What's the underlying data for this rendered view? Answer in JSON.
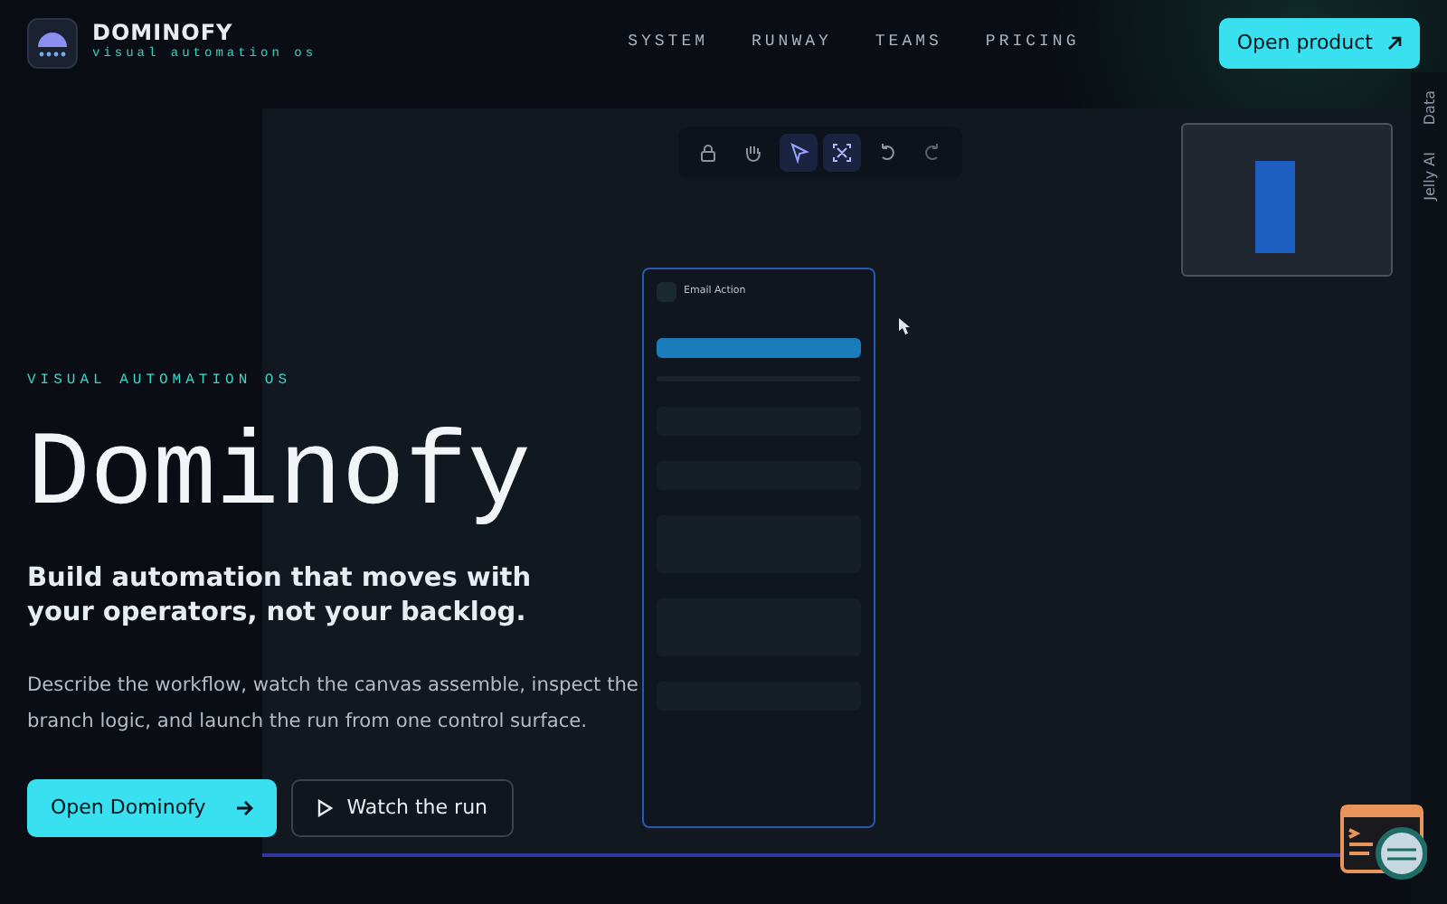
{
  "brand": {
    "name": "DOMINOFY",
    "tagline": "visual automation os"
  },
  "nav": [
    {
      "label": "SYSTEM"
    },
    {
      "label": "RUNWAY"
    },
    {
      "label": "TEAMS"
    },
    {
      "label": "PRICING"
    }
  ],
  "header_button": {
    "label": "Open product"
  },
  "hero": {
    "eyebrow": "VISUAL AUTOMATION OS",
    "title": "Dominofy",
    "subtitle": "Build automation that moves with your operators, not your backlog.",
    "description": "Describe the workflow, watch the canvas assemble, inspect the branch logic, and launch the run from one control surface.",
    "buttons": [
      {
        "kind": "primary",
        "label": "Open Dominofy"
      },
      {
        "kind": "secondary",
        "label": "Watch the run"
      }
    ]
  },
  "canvas": {
    "toolbar": [
      {
        "kind": "lock",
        "selected": false
      },
      {
        "kind": "hand",
        "selected": false
      },
      {
        "kind": "pointer",
        "selected": true
      },
      {
        "kind": "fit",
        "selected": true
      },
      {
        "kind": "undo",
        "selected": false
      },
      {
        "kind": "redo",
        "selected": false
      }
    ],
    "node": {
      "title": "Email Action",
      "fields": [
        {
          "kind": "button"
        },
        {
          "kind": "line"
        },
        {
          "kind": "input"
        },
        {
          "kind": "input"
        },
        {
          "kind": "area"
        },
        {
          "kind": "area"
        },
        {
          "kind": "input"
        }
      ]
    },
    "side_tabs": [
      {
        "label": "Data"
      },
      {
        "label": "Jelly AI"
      }
    ]
  }
}
